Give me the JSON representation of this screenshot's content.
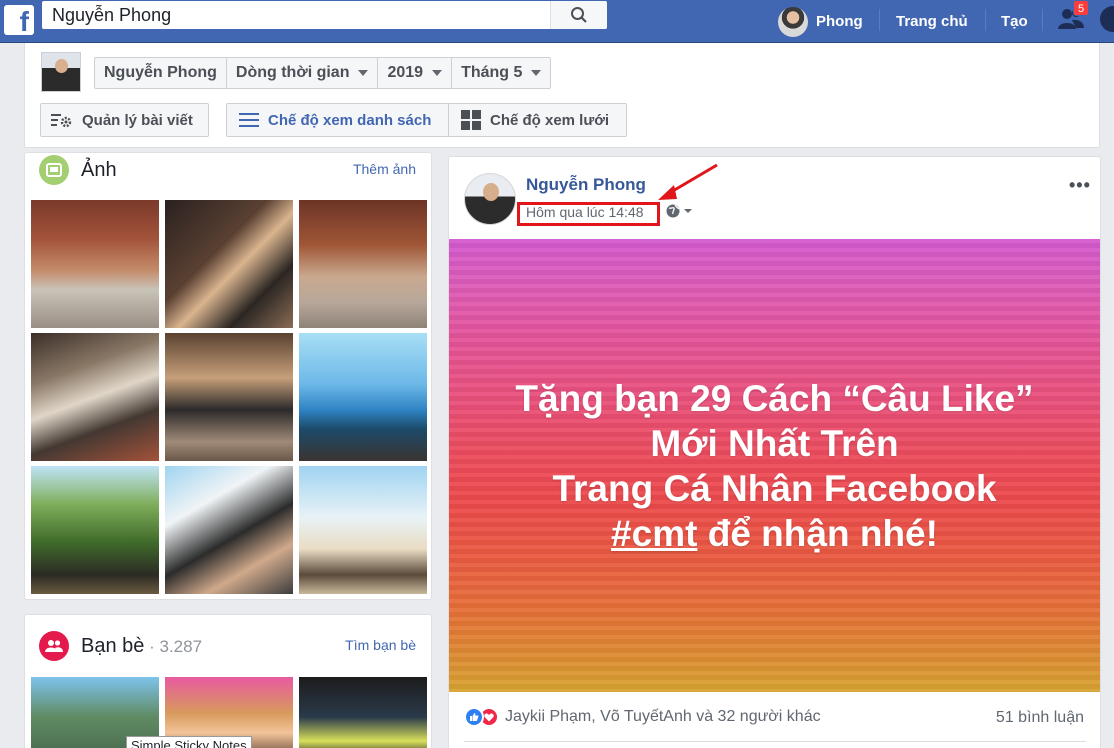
{
  "topbar": {
    "search_value": "Nguyễn Phong",
    "profile_name": "Phong",
    "home_label": "Trang chủ",
    "create_label": "Tạo",
    "notification_count": "5",
    "brand_color": "#4267b2"
  },
  "header": {
    "filters": {
      "name": "Nguyễn Phong",
      "timeline": "Dòng thời gian",
      "year": "2019",
      "month": "Tháng 5"
    },
    "manage_posts": "Quản lý bài viết",
    "list_view": "Chế độ xem danh sách",
    "grid_view": "Chế độ xem lưới"
  },
  "photos": {
    "title": "Ảnh",
    "add_link": "Thêm ảnh"
  },
  "friends": {
    "title": "Bạn bè",
    "count": " · 3.287",
    "find_link": "Tìm bạn bè",
    "tooltip": "Simple Sticky Notes"
  },
  "post": {
    "author": "Nguyễn Phong",
    "time": "Hôm qua lúc 14:48",
    "banner_lines": [
      "Tặng bạn 29 Cách “Câu Like”",
      "Mới Nhất Trên",
      "Trang Cá Nhân Facebook"
    ],
    "banner_hashtag": "#cmt",
    "banner_last": " để nhận nhé!",
    "reactions_text": "Jaykii Phạm, Võ TuyếtAnh và 32 người khác",
    "comments": "51 bình luận"
  },
  "icons": {
    "fb_logo": "f",
    "search": "search-icon",
    "globe": "globe-icon",
    "more": "more-icon"
  }
}
